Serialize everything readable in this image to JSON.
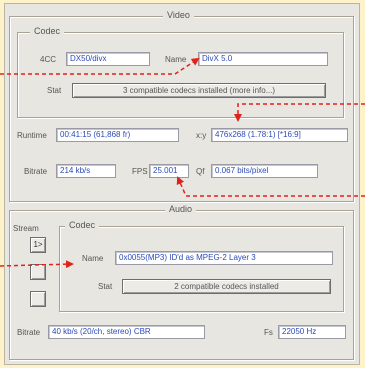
{
  "video": {
    "legend": "Video",
    "codec_legend": "Codec",
    "fourcc_label": "4CC",
    "fourcc_value": "DX50/divx",
    "name_label": "Name",
    "name_value": "DivX 5.0",
    "stat_label": "Stat",
    "stat_button": "3 compatible codecs installed (more info...)",
    "runtime_label": "Runtime",
    "runtime_value": "00:41:15 (61,868 fr)",
    "xy_label": "x:y",
    "xy_value": "476x268 (1.78:1) [*16:9]",
    "bitrate_label": "Bitrate",
    "bitrate_value": "214 kb/s",
    "fps_label": "FPS",
    "fps_value": "25.001",
    "qf_label": "Qf",
    "qf_value": "0.067 bits/pixel"
  },
  "audio": {
    "legend": "Audio",
    "stream_label": "Stream",
    "stream_buttons": [
      "1>",
      "",
      ""
    ],
    "codec_legend": "Codec",
    "name_label": "Name",
    "name_value": "0x0055(MP3) ID'd as MPEG-2 Layer 3",
    "stat_label": "Stat",
    "stat_button": "2 compatible codecs installed",
    "bitrate_label": "Bitrate",
    "bitrate_value": "40 kb/s (20/ch, stereo) CBR",
    "fs_label": "Fs",
    "fs_value": "22050 Hz"
  },
  "colors": {
    "background": "#fdf2c9",
    "arrow": "#e0221b",
    "field_text": "#2b4ab8"
  }
}
